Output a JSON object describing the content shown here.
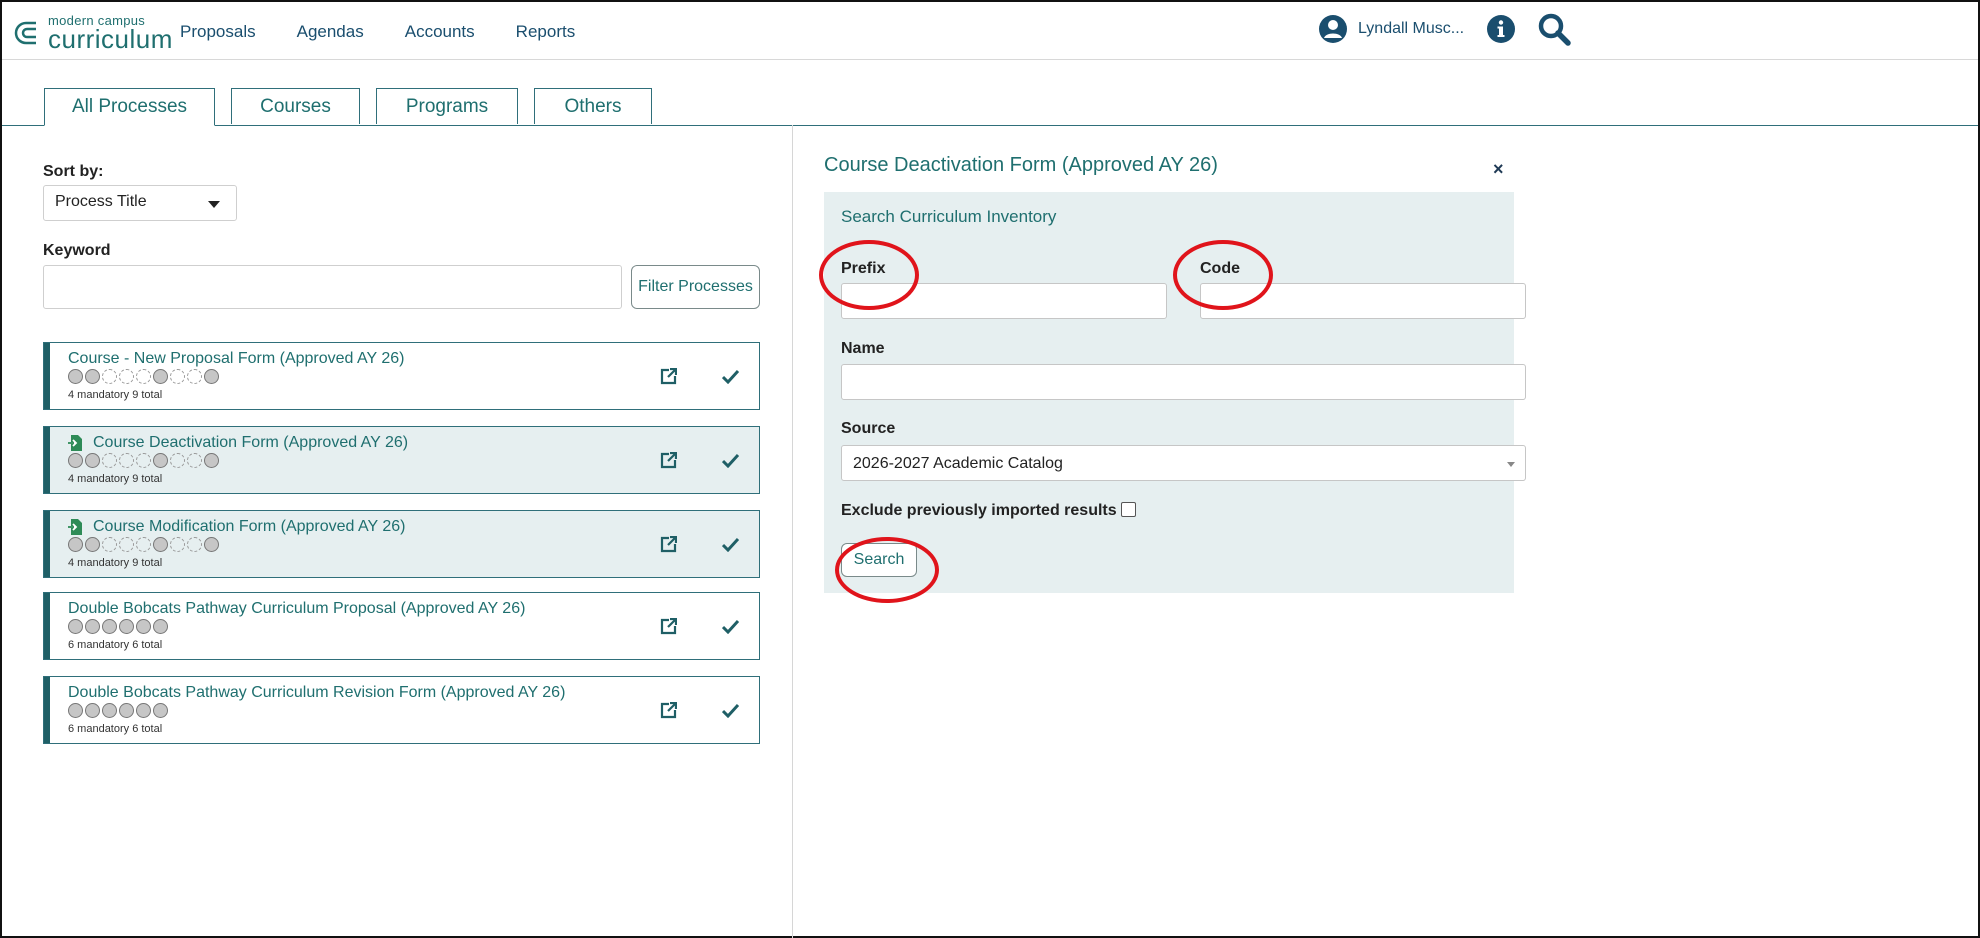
{
  "header": {
    "logo_sub": "modern campus",
    "logo_main": "curriculum",
    "nav": [
      "Proposals",
      "Agendas",
      "Accounts",
      "Reports"
    ],
    "user_name": "Lyndall Musc..."
  },
  "tabs": [
    "All Processes",
    "Courses",
    "Programs",
    "Others"
  ],
  "left": {
    "sort_label": "Sort by:",
    "sort_value": "Process Title",
    "keyword_label": "Keyword",
    "keyword_value": "",
    "filter_button": "Filter Processes",
    "processes": [
      {
        "title": "Course - New Proposal Form (Approved AY 26)",
        "count": "4 mandatory 9 total",
        "circles": "mmooomoom",
        "icon": false,
        "selected": false
      },
      {
        "title": "Course Deactivation Form (Approved AY 26)",
        "count": "4 mandatory 9 total",
        "circles": "mmooomoom",
        "icon": true,
        "selected": true
      },
      {
        "title": "Course Modification Form (Approved AY 26)",
        "count": "4 mandatory 9 total",
        "circles": "mmooomoom",
        "icon": true,
        "selected": true
      },
      {
        "title": "Double Bobcats Pathway Curriculum Proposal (Approved AY 26)",
        "count": "6 mandatory 6 total",
        "circles": "mmmmmm",
        "icon": false,
        "selected": false
      },
      {
        "title": "Double Bobcats Pathway Curriculum Revision Form (Approved AY 26)",
        "count": "6 mandatory 6 total",
        "circles": "mmmmmm",
        "icon": false,
        "selected": false
      }
    ]
  },
  "right": {
    "title": "Course Deactivation Form (Approved AY 26)",
    "close_label": "×",
    "panel_heading": "Search Curriculum Inventory",
    "prefix_label": "Prefix",
    "code_label": "Code",
    "name_label": "Name",
    "source_label": "Source",
    "source_value": "2026-2027 Academic Catalog",
    "exclude_label": "Exclude previously imported results",
    "search_button": "Search"
  },
  "colors": {
    "accent": "#1f6f6f",
    "panel_bg": "#e6eff0",
    "highlight_ring": "#e0141b"
  }
}
